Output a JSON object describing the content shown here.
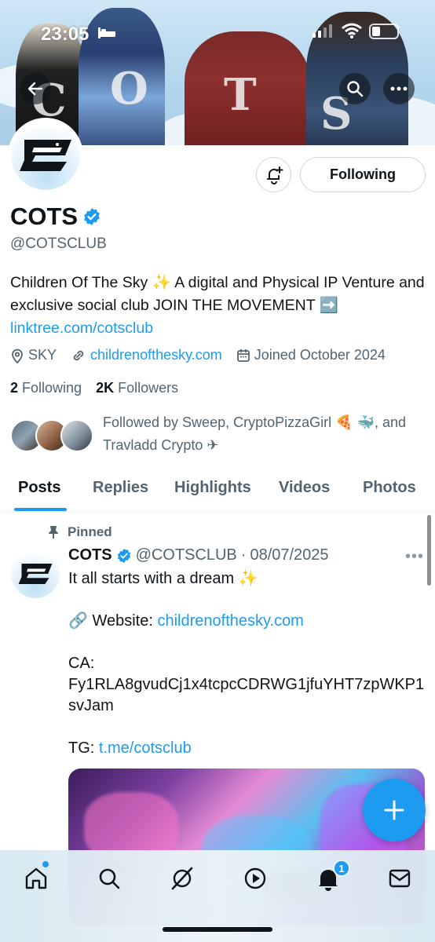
{
  "status_bar": {
    "time": "23:05"
  },
  "profile": {
    "display_name": "COTS",
    "handle": "@COTSCLUB",
    "follow_button_label": "Following",
    "bio_text": "Children Of The Sky ✨ A digital and Physical IP Venture and exclusive social club JOIN THE MOVEMENT ➡️",
    "bio_link": "linktree.com/cotsclub",
    "location": "SKY",
    "website": "childrenofthesky.com",
    "joined": "Joined October 2024",
    "following_count": "2",
    "following_label": "Following",
    "followers_count": "2K",
    "followers_label": "Followers",
    "followed_by": "Followed by Sweep, CryptoPizzaGirl 🍕 🐳, and Travladd Crypto ✈"
  },
  "tabs": [
    {
      "label": "Posts"
    },
    {
      "label": "Replies"
    },
    {
      "label": "Highlights"
    },
    {
      "label": "Videos"
    },
    {
      "label": "Photos"
    }
  ],
  "post": {
    "pinned_label": "Pinned",
    "author_name": "COTS",
    "author_handle": "@COTSCLUB",
    "separator": "·",
    "date": "08/07/2025",
    "line1": "It all starts with a dream ✨",
    "website_prefix": "🔗 Website: ",
    "website_link": "childrenofthesky.com",
    "ca_label": "CA:",
    "ca_value": "Fy1RLA8gvudCj1x4tcpcCDRWG1jfuYHT7zpWKP1svJam",
    "tg_prefix": "TG: ",
    "tg_link": "t.me/cotsclub"
  },
  "bottom_nav": {
    "items": [
      "home-icon",
      "search-icon",
      "grok-icon",
      "video-icon",
      "notifications-icon",
      "messages-icon"
    ],
    "notification_badge": "1"
  },
  "colors": {
    "accent": "#1d9bf0",
    "text": "#0f1419",
    "secondary": "#536471"
  }
}
